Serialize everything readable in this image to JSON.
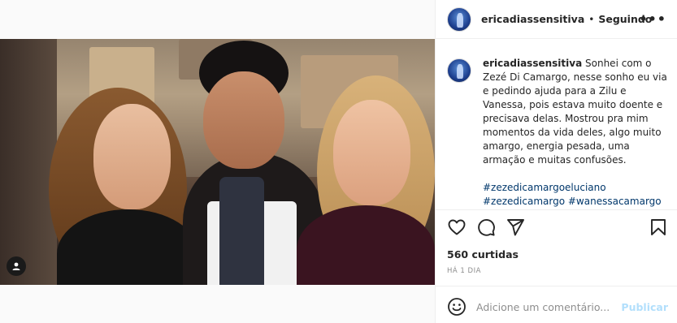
{
  "post": {
    "username": "ericadiassensitiva",
    "separator": "•",
    "follow_status": "Seguindo",
    "more_label": "•••"
  },
  "caption": {
    "username": "ericadiassensitiva",
    "text": "Sonhei com o Zezé Di Camargo, nesse sonho eu via e pedindo ajuda para a Zilu e Vanessa, pois estava muito doente e precisava delas. Mostrou pra mim momentos da vida deles, algo muito amargo, energia pesada, uma armação e muitas confusões.",
    "hashtags": [
      "#zezedicamargoeluciano",
      "#zezedicamargo",
      "#wanessacamargo"
    ]
  },
  "actions": {
    "icons": [
      "heart-icon",
      "comment-icon",
      "share-icon",
      "bookmark-icon"
    ]
  },
  "likes": "560 curtidas",
  "timestamp": "HÁ 1 DIA",
  "comment": {
    "placeholder": "Adicione um comentário...",
    "publish_label": "Publicar"
  },
  "colors": {
    "link": "#00376b",
    "publish_disabled": "#b2dffc",
    "muted": "#8e8e8e"
  }
}
